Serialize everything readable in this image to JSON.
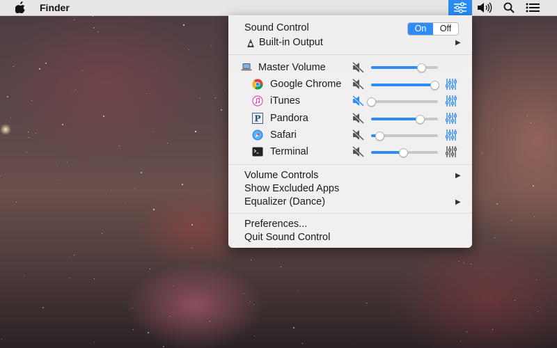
{
  "menubar": {
    "app_name": "Finder",
    "icons": [
      "apple-icon",
      "sliders-icon",
      "volume-icon",
      "search-icon",
      "list-icon"
    ],
    "active_color": "#2a8cf3"
  },
  "menu": {
    "title": "Sound Control",
    "toggle": {
      "on": "On",
      "off": "Off",
      "selected": "On"
    },
    "output": "Built-in Output",
    "master": {
      "label": "Master Volume",
      "volume": 0.75,
      "muted": false
    },
    "apps": [
      {
        "label": "Google Chrome",
        "icon": "chrome-icon",
        "volume": 0.95,
        "muted": false,
        "eq_active": true
      },
      {
        "label": "iTunes",
        "icon": "itunes-icon",
        "volume": 0.0,
        "muted": true,
        "eq_active": true
      },
      {
        "label": "Pandora",
        "icon": "pandora-icon",
        "volume": 0.73,
        "muted": false,
        "eq_active": true
      },
      {
        "label": "Safari",
        "icon": "safari-icon",
        "volume": 0.12,
        "muted": false,
        "eq_active": true
      },
      {
        "label": "Terminal",
        "icon": "terminal-icon",
        "volume": 0.48,
        "muted": false,
        "eq_active": false
      }
    ],
    "items_group1": [
      "Volume Controls",
      "Show Excluded Apps",
      "Equalizer (Dance)"
    ],
    "items_group2": [
      "Preferences...",
      "Quit Sound Control"
    ],
    "accent_color": "#2f8cf5",
    "muted_color": "#2f8cf5"
  }
}
